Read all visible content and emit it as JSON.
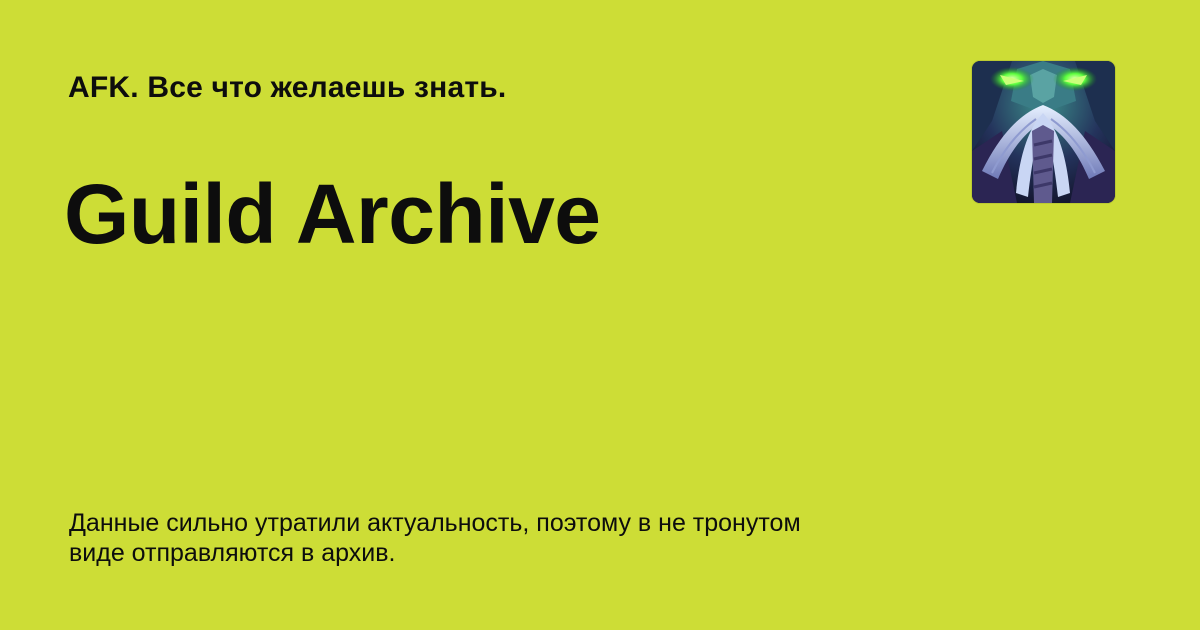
{
  "header": {
    "site_name": "AFK. Все что желаешь знать."
  },
  "main": {
    "title": "Guild Archive",
    "description": "Данные сильно утратили актуальность, поэтому в не тронутом виде отправляются в архив."
  },
  "logo": {
    "icon": "guild-emblem-icon"
  },
  "colors": {
    "background": "#cddd36",
    "text": "#0d0d0d",
    "logo_glow": "#39ff3a",
    "logo_dark": "#1a1b3a"
  }
}
